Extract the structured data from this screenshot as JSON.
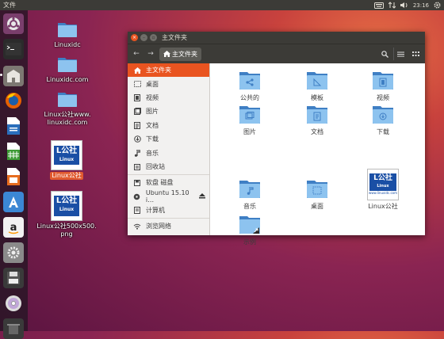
{
  "top_panel": {
    "app_menu": "文件",
    "clock": "23:16"
  },
  "launcher": {
    "items": [
      "dash",
      "terminal",
      "files",
      "firefox",
      "writer",
      "calc",
      "impress",
      "software",
      "amazon",
      "settings",
      "floppy",
      "dvd",
      "trash"
    ]
  },
  "desktop": {
    "icons": [
      {
        "label": "Linuxidc"
      },
      {
        "label": "Linuxidc.com"
      },
      {
        "label": "Linux公社www.\nlinuxidc.com"
      },
      {
        "label": "Linux公社"
      },
      {
        "label": "Linux公社500x500.\npng"
      }
    ]
  },
  "window": {
    "title": "主文件夹",
    "breadcrumb": "主文件夹",
    "sidebar": {
      "items": [
        {
          "label": "主文件夹",
          "icon": "home-icon"
        },
        {
          "label": "桌面",
          "icon": "desktop-icon"
        },
        {
          "label": "视频",
          "icon": "video-icon"
        },
        {
          "label": "图片",
          "icon": "picture-icon"
        },
        {
          "label": "文档",
          "icon": "document-icon"
        },
        {
          "label": "下载",
          "icon": "download-icon"
        },
        {
          "label": "音乐",
          "icon": "music-icon"
        },
        {
          "label": "回收站",
          "icon": "trash-icon"
        }
      ],
      "devices": [
        {
          "label": "软盘 磁盘",
          "icon": "floppy-icon"
        },
        {
          "label": "Ubuntu 15.10 i…",
          "icon": "disc-icon"
        },
        {
          "label": "计算机",
          "icon": "computer-icon"
        }
      ],
      "network": [
        {
          "label": "浏览网络",
          "icon": "network-icon"
        }
      ]
    },
    "files": [
      {
        "label": "公共的",
        "kind": "public"
      },
      {
        "label": "模板",
        "kind": "templates"
      },
      {
        "label": "视频",
        "kind": "videos"
      },
      {
        "label": "图片",
        "kind": "pictures"
      },
      {
        "label": "文档",
        "kind": "documents"
      },
      {
        "label": "下载",
        "kind": "downloads"
      },
      {
        "label": "音乐",
        "kind": "music"
      },
      {
        "label": "桌面",
        "kind": "desktop"
      },
      {
        "label": "Linux公社",
        "kind": "image"
      },
      {
        "label": "示例",
        "kind": "examples"
      }
    ],
    "logo_text": {
      "main": "公社",
      "sub": "Linux",
      "url": "www.linuxidc.com"
    }
  },
  "colors": {
    "accent": "#e95420",
    "panel": "#3c3b37",
    "folder": "#7fb2e0"
  }
}
